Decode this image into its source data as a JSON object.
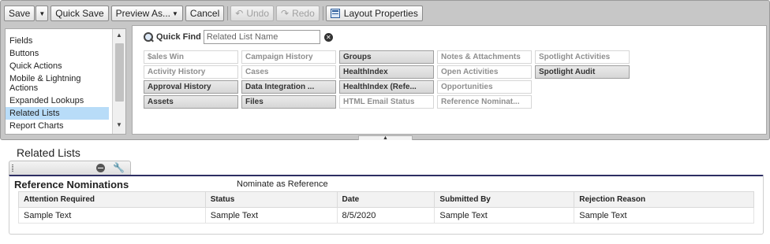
{
  "toolbar": {
    "save": "Save",
    "quick_save": "Quick Save",
    "preview_as": "Preview As...",
    "cancel": "Cancel",
    "undo": "Undo",
    "redo": "Redo",
    "layout_properties": "Layout Properties"
  },
  "palette_list": {
    "items": [
      "Fields",
      "Buttons",
      "Quick Actions",
      "Mobile & Lightning Actions",
      "Expanded Lookups",
      "Related Lists",
      "Report Charts"
    ],
    "selected": "Related Lists"
  },
  "quick_find": {
    "label": "Quick Find",
    "placeholder": "Related List Name"
  },
  "palette_items": [
    [
      "$ales Win",
      "Campaign History",
      "Groups",
      "Notes & Attachments",
      "Spotlight Activities"
    ],
    [
      "Activity History",
      "Cases",
      "HealthIndex",
      "Open Activities",
      "Spotlight Audit"
    ],
    [
      "Approval History",
      "Data Integration ...",
      "HealthIndex (Refe...",
      "Opportunities",
      ""
    ],
    [
      "Assets",
      "Files",
      "HTML Email Status",
      "Reference Nominat...",
      ""
    ]
  ],
  "layout": {
    "section_title": "Related Lists",
    "related_list": {
      "title": "Reference Nominations",
      "button_label": "Nominate as Reference",
      "columns": [
        "Attention Required",
        "Status",
        "Date",
        "Submitted By",
        "Rejection Reason"
      ],
      "row": [
        "Sample Text",
        "Sample Text",
        "8/5/2020",
        "Sample Text",
        "Sample Text"
      ]
    }
  }
}
